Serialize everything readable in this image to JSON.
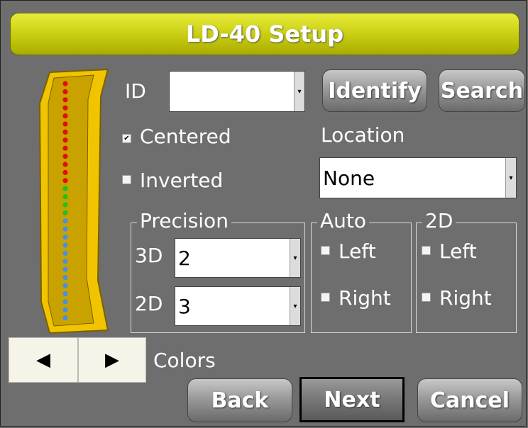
{
  "title": "LD-40 Setup",
  "id_label": "ID",
  "id_value": "",
  "buttons": {
    "identify": "Identify",
    "search": "Search",
    "back": "Back",
    "next": "Next",
    "cancel": "Cancel"
  },
  "checkboxes": {
    "centered": {
      "label": "Centered",
      "checked": true
    },
    "inverted": {
      "label": "Inverted",
      "checked": false
    }
  },
  "location": {
    "label": "Location",
    "value": "None"
  },
  "precision": {
    "legend": "Precision",
    "d3": {
      "label": "3D",
      "value": "2"
    },
    "d2": {
      "label": "2D",
      "value": "3"
    }
  },
  "auto": {
    "legend": "Auto",
    "left": "Left",
    "right": "Right"
  },
  "twod": {
    "legend": "2D",
    "left": "Left",
    "right": "Right"
  },
  "colors_label": "Colors",
  "led_colors": {
    "red": "#e01010",
    "green": "#20c020",
    "blue": "#4a8fe0",
    "body": "#f0c400"
  },
  "icons": [
    "left-arrow-icon",
    "right-arrow-icon",
    "dropdown-arrow-icon",
    "lightbar-device-icon"
  ]
}
